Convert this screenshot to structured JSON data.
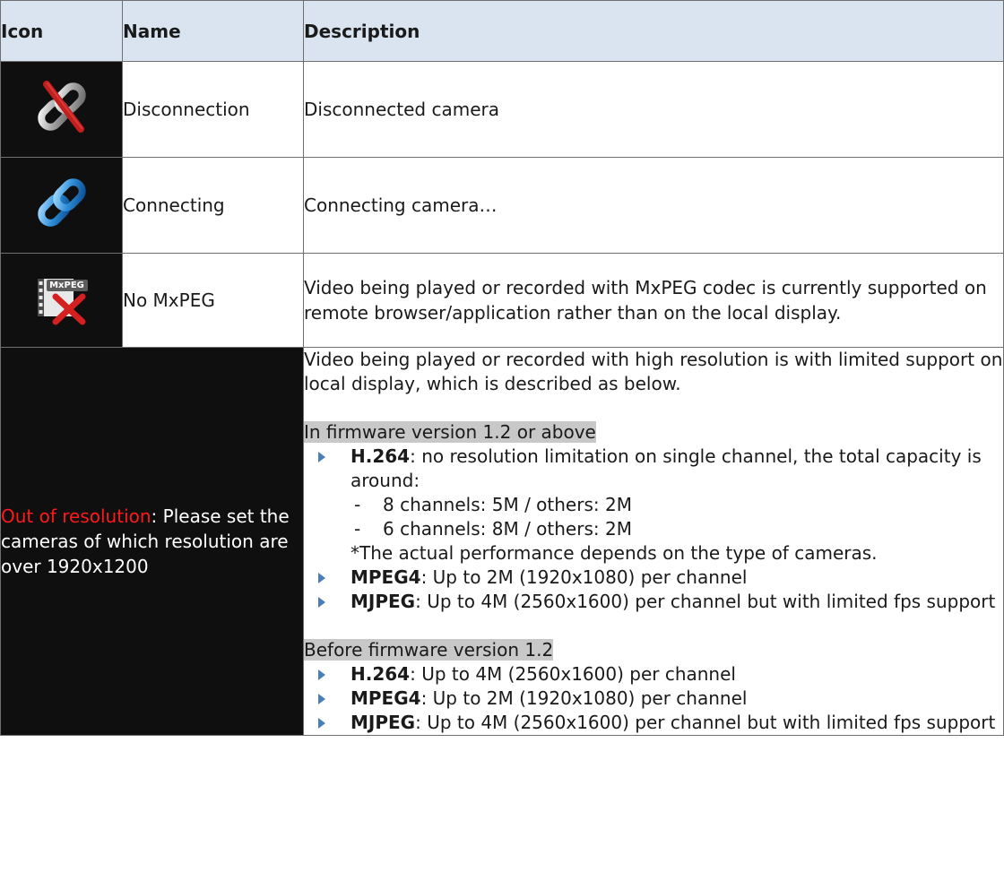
{
  "headers": {
    "icon": "Icon",
    "name": "Name",
    "description": "Description"
  },
  "rows": [
    {
      "icon": "disconnection-icon",
      "name": "Disconnection",
      "description": "Disconnected camera"
    },
    {
      "icon": "connecting-icon",
      "name": "Connecting",
      "description": "Connecting camera…"
    },
    {
      "icon": "no-mxpeg-icon",
      "icon_badge": "MxPEG",
      "name": "No MxPEG",
      "description": "Video being played or recorded with MxPEG codec is currently supported on remote browser/application rather than on the local display."
    }
  ],
  "out_of_resolution": {
    "title": "Out of resolution",
    "text": ": Please set the cameras of which resolution are over 1920x1200",
    "intro": "Video being played or recorded with high resolution is with limited support on local display, which is described as below.",
    "section1": {
      "heading": "In firmware version 1.2 or above",
      "items": [
        {
          "codec": "H.264",
          "text": ": no resolution limitation on single channel, the total capacity is around:",
          "sub": [
            "8 channels: 5M / others: 2M",
            "6 channels: 8M / others: 2M"
          ],
          "note": "*The actual performance depends on the type of cameras."
        },
        {
          "codec": "MPEG4",
          "text": ": Up to 2M (1920x1080) per channel"
        },
        {
          "codec": "MJPEG",
          "text": ": Up to 4M (2560x1600) per channel but with limited fps support"
        }
      ]
    },
    "section2": {
      "heading": "Before firmware version 1.2",
      "items": [
        {
          "codec": "H.264",
          "text": ": Up to 4M (2560x1600) per channel"
        },
        {
          "codec": "MPEG4",
          "text": ": Up to 2M (1920x1080) per channel"
        },
        {
          "codec": "MJPEG",
          "text": ": Up to 4M (2560x1600) per channel but with limited fps support"
        }
      ]
    }
  },
  "colors": {
    "header_bg": "#dae4f1",
    "icon_cell_bg": "#0f0f0f",
    "highlight_red": "#ff1a1a",
    "bullet_blue": "#4a7ebb",
    "section_highlight": "#c8c8c8"
  }
}
